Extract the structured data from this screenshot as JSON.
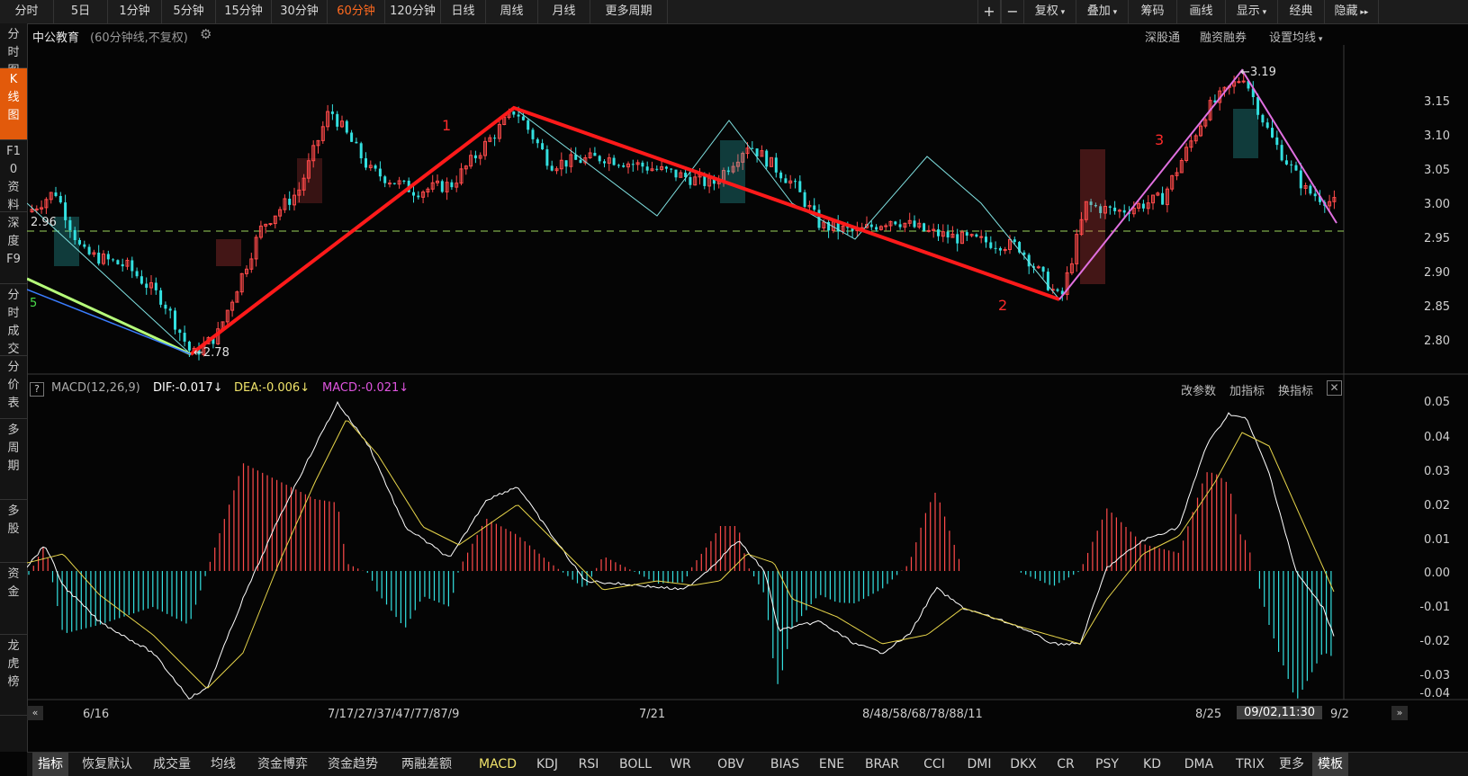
{
  "toolbar": {
    "periods": [
      "分时",
      "5日",
      "1分钟",
      "5分钟",
      "15分钟",
      "30分钟",
      "60分钟",
      "120分钟",
      "日线",
      "周线",
      "月线",
      "更多周期"
    ],
    "active_period": "60分钟",
    "right_buttons": [
      "复权",
      "叠加",
      "筹码",
      "画线",
      "显示",
      "经典",
      "隐藏"
    ]
  },
  "sidebar": {
    "items": [
      "分时图",
      "K线图",
      "F10资料",
      "深度F9",
      "分时成交",
      "分价表",
      "多周期",
      "多股",
      "资金",
      "龙虎榜"
    ],
    "active": "K线图"
  },
  "stock": {
    "name": "中公教育",
    "period_desc": "(60分钟线,不复权)"
  },
  "main_links": [
    "深股通",
    "融资融券",
    "设置均线"
  ],
  "price_axis": [
    "3.15",
    "3.10",
    "3.05",
    "3.00",
    "2.95",
    "2.90",
    "2.85",
    "2.80"
  ],
  "price_annotations": {
    "high": "3.19",
    "low": "2.78",
    "left": "2.96",
    "left_edge": "5"
  },
  "wave_labels": [
    "1",
    "2",
    "3"
  ],
  "indicator": {
    "name": "MACD(12,26,9)",
    "dif": "DIF:-0.017",
    "dea": "DEA:-0.006",
    "macd": "MACD:-0.021",
    "links": [
      "改参数",
      "加指标",
      "换指标"
    ]
  },
  "macd_axis": [
    "0.05",
    "0.04",
    "0.03",
    "0.02",
    "0.01",
    "0.00",
    "-0.01",
    "-0.02",
    "-0.03",
    "-0.04"
  ],
  "dates": [
    "6/16",
    "7/17/27/37/47/77/87/9",
    "7/21",
    "8/48/58/68/78/88/11",
    "8/25",
    "09/02,11:30",
    "9/2"
  ],
  "bottom_tabs": [
    "指标",
    "恢复默认",
    "成交量",
    "均线",
    "资金博弈",
    "资金趋势",
    "两融差额",
    "MACD",
    "KDJ",
    "RSI",
    "BOLL",
    "WR",
    "OBV",
    "BIAS",
    "ENE",
    "BRAR",
    "CCI",
    "DMI",
    "DKX",
    "CR",
    "PSY",
    "KD",
    "DMA",
    "TRIX",
    "更多",
    "模板"
  ],
  "colors": {
    "up": "#ff4a4a",
    "down": "#33e0e0",
    "accent": "#e25a0b",
    "dif": "#ffffff",
    "dea": "#f0e36a",
    "macd": "#e055e0",
    "wave": "#ff1a1a",
    "wave3": "#e070e0"
  }
}
